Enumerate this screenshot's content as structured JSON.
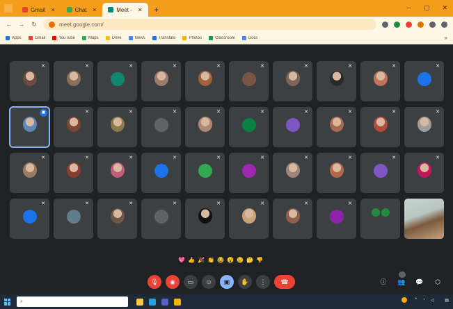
{
  "browser": {
    "tabs": [
      {
        "title": "Gmail",
        "fav_color": "#ea4335",
        "active": false
      },
      {
        "title": "Chat",
        "fav_color": "#34a853",
        "active": false
      },
      {
        "title": "Meet - ",
        "fav_color": "#00897b",
        "active": true
      }
    ],
    "url": "meet.google.com/",
    "bookmarks": [
      {
        "label": "Apps",
        "color": "#1a73e8"
      },
      {
        "label": "Gmail",
        "color": "#ea4335"
      },
      {
        "label": "YouTube",
        "color": "#ff0000"
      },
      {
        "label": "Maps",
        "color": "#34a853"
      },
      {
        "label": "Drive",
        "color": "#fbbc04"
      },
      {
        "label": "News",
        "color": "#4285f4"
      },
      {
        "label": "Translate",
        "color": "#1a73e8"
      },
      {
        "label": "Photos",
        "color": "#f4b400"
      },
      {
        "label": "Classroom",
        "color": "#0f9d58"
      },
      {
        "label": "Docs",
        "color": "#4285f4"
      }
    ],
    "bookmarks_more": "»"
  },
  "meeting": {
    "participants": [
      {
        "name": "",
        "type": "photo",
        "color": "#6b4b3e"
      },
      {
        "name": "",
        "type": "photo",
        "color": "#8a6d5a"
      },
      {
        "name": "",
        "type": "letter",
        "letter": "",
        "color": "#12876f"
      },
      {
        "name": "",
        "type": "photo",
        "color": "#9c7b69"
      },
      {
        "name": "",
        "type": "photo",
        "color": "#a0623f"
      },
      {
        "name": "",
        "type": "letter",
        "letter": "",
        "color": "#795548"
      },
      {
        "name": "",
        "type": "photo",
        "color": "#7d6657"
      },
      {
        "name": "",
        "type": "photo",
        "color": "#2a2a2a"
      },
      {
        "name": "",
        "type": "photo",
        "color": "#c0725a"
      },
      {
        "name": "",
        "type": "letter",
        "letter": "",
        "color": "#1a73e8"
      },
      {
        "name": "",
        "type": "photo",
        "color": "#5d88b8",
        "selected": true
      },
      {
        "name": "",
        "type": "photo",
        "color": "#7a4632"
      },
      {
        "name": "",
        "type": "photo",
        "color": "#8c7a4e"
      },
      {
        "name": "",
        "type": "letter",
        "letter": "",
        "color": "#5f6368"
      },
      {
        "name": "",
        "type": "photo",
        "color": "#b08a70"
      },
      {
        "name": "",
        "type": "letter",
        "letter": "",
        "color": "#0b8043"
      },
      {
        "name": "",
        "type": "letter",
        "letter": "",
        "color": "#7e57c2"
      },
      {
        "name": "",
        "type": "photo",
        "color": "#a86b52"
      },
      {
        "name": "",
        "type": "photo",
        "color": "#b24b3a"
      },
      {
        "name": "",
        "type": "photo",
        "color": "#9e9e9e"
      },
      {
        "name": "",
        "type": "photo",
        "color": "#9b7b63"
      },
      {
        "name": "",
        "type": "photo",
        "color": "#8b3d2c"
      },
      {
        "name": "",
        "type": "photo",
        "color": "#c05d7a"
      },
      {
        "name": "",
        "type": "letter",
        "letter": "",
        "color": "#1a73e8"
      },
      {
        "name": "",
        "type": "letter",
        "letter": "",
        "color": "#33a852"
      },
      {
        "name": "",
        "type": "letter",
        "letter": "",
        "color": "#9c27b0"
      },
      {
        "name": "",
        "type": "photo",
        "color": "#a0837a"
      },
      {
        "name": "",
        "type": "photo",
        "color": "#b36a4a"
      },
      {
        "name": "",
        "type": "letter",
        "letter": "",
        "color": "#7e57c2"
      },
      {
        "name": "",
        "type": "photo",
        "color": "#c2185b"
      },
      {
        "name": "",
        "type": "letter",
        "letter": "",
        "color": "#1a73e8"
      },
      {
        "name": "",
        "type": "letter",
        "letter": "",
        "color": "#607d8b"
      },
      {
        "name": "",
        "type": "photo",
        "color": "#6f5646"
      },
      {
        "name": "",
        "type": "letter",
        "letter": "",
        "color": "#5f6368"
      },
      {
        "name": "",
        "type": "photo",
        "color": "#111111"
      },
      {
        "name": "",
        "type": "photo",
        "color": "#c9a27a"
      },
      {
        "name": "",
        "type": "photo",
        "color": "#8f5e4d"
      },
      {
        "name": "",
        "type": "letter",
        "letter": "",
        "color": "#8e24aa"
      },
      {
        "name": "",
        "type": "more",
        "color": "#1e8e3e"
      },
      {
        "name": "",
        "type": "video",
        "color": "#c8d2cf"
      }
    ],
    "reactions": [
      "💖",
      "👍",
      "🎉",
      "👏",
      "😂",
      "😮",
      "😢",
      "🤔",
      "👎"
    ],
    "time": "",
    "meeting_code": "",
    "participant_count": ""
  },
  "controls": {
    "mic": "🎙",
    "camera": "◉",
    "captions": "▭",
    "reactions": "☺",
    "present": "▣",
    "raise_hand": "✋",
    "more": "⋮",
    "end": "☎",
    "info": "ⓘ",
    "people": "👥",
    "chat": "💬",
    "activities": "⬡"
  },
  "taskbar": {
    "search_placeholder": "",
    "apps": [
      {
        "name": "file-explorer",
        "color": "#ffc83d"
      },
      {
        "name": "edge",
        "color": "#1fa2e0"
      },
      {
        "name": "store",
        "color": "#5b5fc7"
      },
      {
        "name": "chrome",
        "color": "#f4b400"
      }
    ],
    "weather": "",
    "time": "",
    "date": ""
  }
}
